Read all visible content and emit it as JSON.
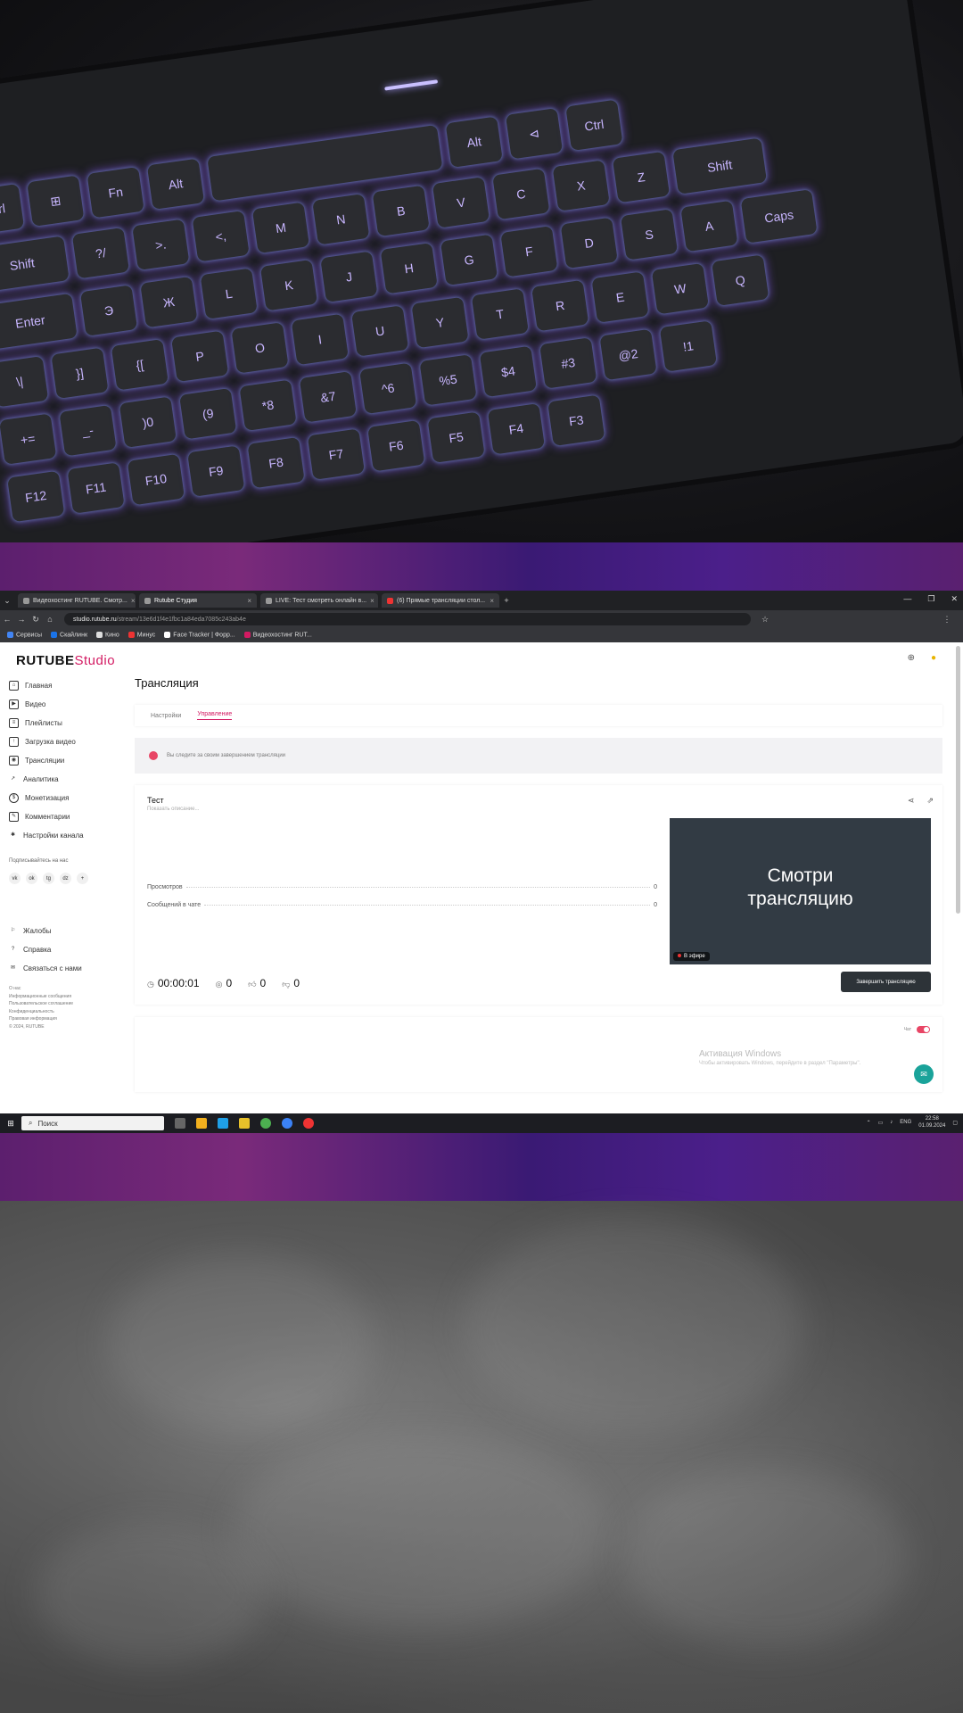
{
  "browser": {
    "tabs": [
      {
        "label": "Видеохостинг RUTUBE. Смотр..."
      },
      {
        "label": "Rutube Студия"
      },
      {
        "label": "LIVE: Тест смотреть онлайн в..."
      },
      {
        "label": "(6) Прямые трансляции стол..."
      }
    ],
    "url_host": "studio.rutube.ru",
    "url_path": "/stream/13e6d1f4e1fbc1a84eda7085c243ab4e",
    "bookmarks": [
      "Сервисы",
      "Скайлинк",
      "Кино",
      "Минус",
      "Face Tracker | Форр...",
      "Видеохостинг RUT..."
    ]
  },
  "app": {
    "logo_main": "RUTUBE",
    "logo_studio": "Studio",
    "nav": [
      {
        "label": "Главная",
        "icon": "home-icon"
      },
      {
        "label": "Видео",
        "icon": "video-icon"
      },
      {
        "label": "Плейлисты",
        "icon": "playlist-icon"
      },
      {
        "label": "Загрузка видео",
        "icon": "upload-icon"
      },
      {
        "label": "Трансляции",
        "icon": "broadcast-icon"
      },
      {
        "label": "Аналитика",
        "icon": "analytics-icon"
      },
      {
        "label": "Монетизация",
        "icon": "money-icon"
      },
      {
        "label": "Комментарии",
        "icon": "comment-icon"
      },
      {
        "label": "Настройки канала",
        "icon": "settings-icon"
      }
    ],
    "subscribe_label": "Подписывайтесь на нас",
    "socials": [
      "vk",
      "ok",
      "tg",
      "dz",
      "+"
    ],
    "help": [
      {
        "label": "Жалобы",
        "icon": "report-icon"
      },
      {
        "label": "Справка",
        "icon": "help-icon"
      },
      {
        "label": "Связаться с нами",
        "icon": "contact-icon"
      }
    ],
    "footer_links": [
      "О нас",
      "Информационные сообщения",
      "Пользовательское соглашение",
      "Конфиденциальность",
      "Правовая информация",
      "© 2024, RUTUBE"
    ],
    "page_title": "Трансляция",
    "subtabs": [
      {
        "label": "Настройки"
      },
      {
        "label": "Управление"
      }
    ],
    "notice": "Вы следите за своим завершением трансляции",
    "stream": {
      "title": "Тест",
      "description": "Показать описание...",
      "stats": [
        {
          "label": "Просмотров",
          "value": "0"
        },
        {
          "label": "Сообщений в чате",
          "value": "0"
        }
      ],
      "preview_text_line1": "Смотри",
      "preview_text_line2": "трансляцию",
      "live_label": "В эфире",
      "duration": "00:00:01",
      "viewers": "0",
      "likes": "0",
      "dislikes": "0",
      "end_button": "Завершить трансляцию"
    },
    "chat_toggle_label": "Чат",
    "watermark_title": "Активация Windows",
    "watermark_sub": "Чтобы активировать Windows, перейдите в раздел \"Параметры\"."
  },
  "taskbar": {
    "search_placeholder": "Поиск",
    "lang": "ENG",
    "time": "22:58",
    "date": "01.09.2024"
  },
  "colors": {
    "accent": "#d31a62",
    "live_red": "#e84565",
    "preview_bg": "#323b44",
    "fab": "#1aa39a"
  }
}
